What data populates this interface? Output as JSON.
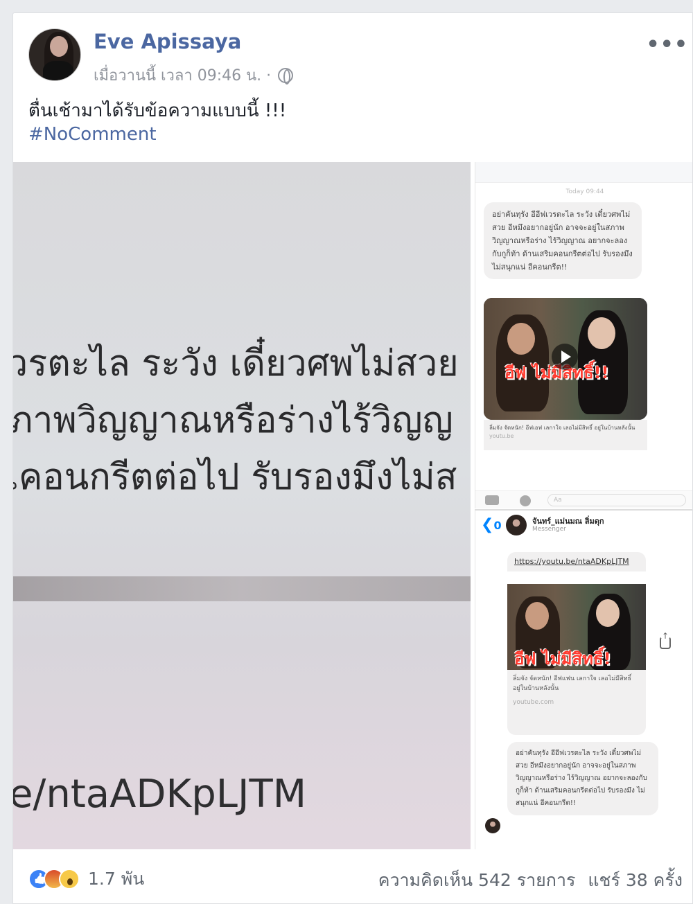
{
  "post": {
    "author": "Eve Apissaya",
    "timestamp": "เมื่อวานนี้ เวลา 09:46 น. ·",
    "privacy_icon": "globe-icon",
    "text": "ตื่นเช้ามาได้รับข้อความแบบนี้ !!!",
    "hashtag": "#NoComment",
    "more_icon": "more-options-icon",
    "more_label": "•••"
  },
  "image_left": {
    "lines": [
      "วรตะไล ระวัง เดี๋ยวศพไม่สวย",
      "ภาพวิญญาณหรือร่างไร้วิญญ",
      "เคอนกรีตต่อไป รับรองมึงไม่ส"
    ],
    "url": "e/ntaADKpLJTM"
  },
  "screenshot_top": {
    "date": "Today 09:44",
    "message": "อย่าคันทุรัง อีอีฟเวรตะไล ระวัง เดี๋ยวศพไม่สวย อีหมึงอยากอยู่นัก อาจจะอยู่ในสภาพวิญญาณหรือร่าง ไร้วิญญาณ อยากจะลองกับกูก็ท้า ด้านเสริมคอนกรีตต่อไป รับรองมึง ไม่สนุกแน่ อีคอนกรีต!!",
    "video_title": "อีฟ ไม่มีสิทธิ์!!",
    "video_caption": "ลิ่มจัง จัดหนัก! อีฟเอฟ เลกาใจ เลอไม่มีสิทธิ์ อยู่ในบ้านหลังนั้น",
    "video_source": "youtu.be",
    "input_placeholder": "Aa"
  },
  "screenshot_bottom": {
    "back_label": "❮",
    "back_count": "0",
    "contact_name": "จันทร์_แม่นมณ ลิ่มดุก",
    "contact_sub": "Messenger",
    "link_text": "https://youtu.be/ntaADKpLJTM",
    "video_title": "อีฟ ไม่มีสิทธิ์!",
    "video_caption": "ลิ่มจัง จัดหนัก! อีฟแฟน เลกาใจ เลอไม่มีสิทธิ์ อยู่ในบ้านหลังนั้น",
    "video_source": "youtube.com",
    "message": "อย่าคันทุรัง อีอีฟเวรตะไล ระวัง เดี๋ยวศพไม่สวย อีหมึงอยากอยู่นัก อาจจะอยู่ในสภาพวิญญาณหรือร่าง ไร้วิญญาณ อยากจะลองกับกูก็ท้า ด้านเสริมคอนกรีตต่อไป รับรองมึง ไม่สนุกแน่ อีคอนกรีต!!"
  },
  "footer": {
    "reaction_icons": [
      "like-icon",
      "angry-icon",
      "wow-icon"
    ],
    "reaction_count": "1.7 พัน",
    "comments": "ความคิดเห็น 542 รายการ",
    "shares": "แชร์ 38 ครั้ง"
  },
  "colors": {
    "link_blue": "#4b67a1",
    "messenger_blue": "#0084ff",
    "meta_gray": "#90949c"
  }
}
